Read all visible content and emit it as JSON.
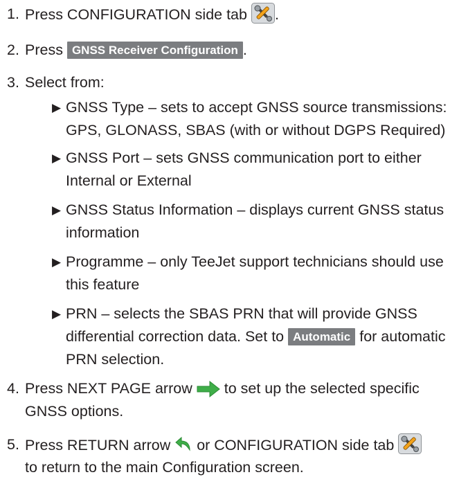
{
  "steps": [
    {
      "num": "1.",
      "before": "Press CONFIGURATION side tab",
      "after": "."
    },
    {
      "num": "2.",
      "before": "Press",
      "button": "GNSS Receiver Configuration",
      "after": "."
    },
    {
      "num": "3.",
      "text": "Select from:"
    },
    {
      "num": "4.",
      "before": "Press NEXT PAGE arrow",
      "after": "to set up the selected specific",
      "cont": "GNSS options."
    },
    {
      "num": "5.",
      "before": "Press RETURN arrow",
      "mid": "or CONFIGURATION side tab",
      "cont": "to return to the main Configuration screen."
    }
  ],
  "options": [
    {
      "lines": [
        "GNSS Type – sets to accept GNSS source transmissions:",
        "GPS, GLONASS, SBAS (with or without DGPS Required)"
      ]
    },
    {
      "lines": [
        "GNSS Port – sets GNSS communication port to either",
        "Internal or External"
      ]
    },
    {
      "lines": [
        "GNSS Status Information – displays current GNSS status",
        "information"
      ]
    },
    {
      "lines": [
        "Programme – only TeeJet support technicians should use",
        "this feature"
      ]
    },
    {
      "line1": "PRN – selects the SBAS PRN that will provide GNSS",
      "line2_before": "differential correction data. Set to",
      "button": "Automatic",
      "line2_after": "for automatic",
      "line3": "PRN selection."
    }
  ],
  "icons": {
    "configuration": "configuration-tools-icon",
    "next_page": "next-page-arrow-icon",
    "return": "return-arrow-icon"
  },
  "colors": {
    "button_bg": "#7b7d80",
    "arrow_green": "#3fae49",
    "text": "#231f20"
  }
}
